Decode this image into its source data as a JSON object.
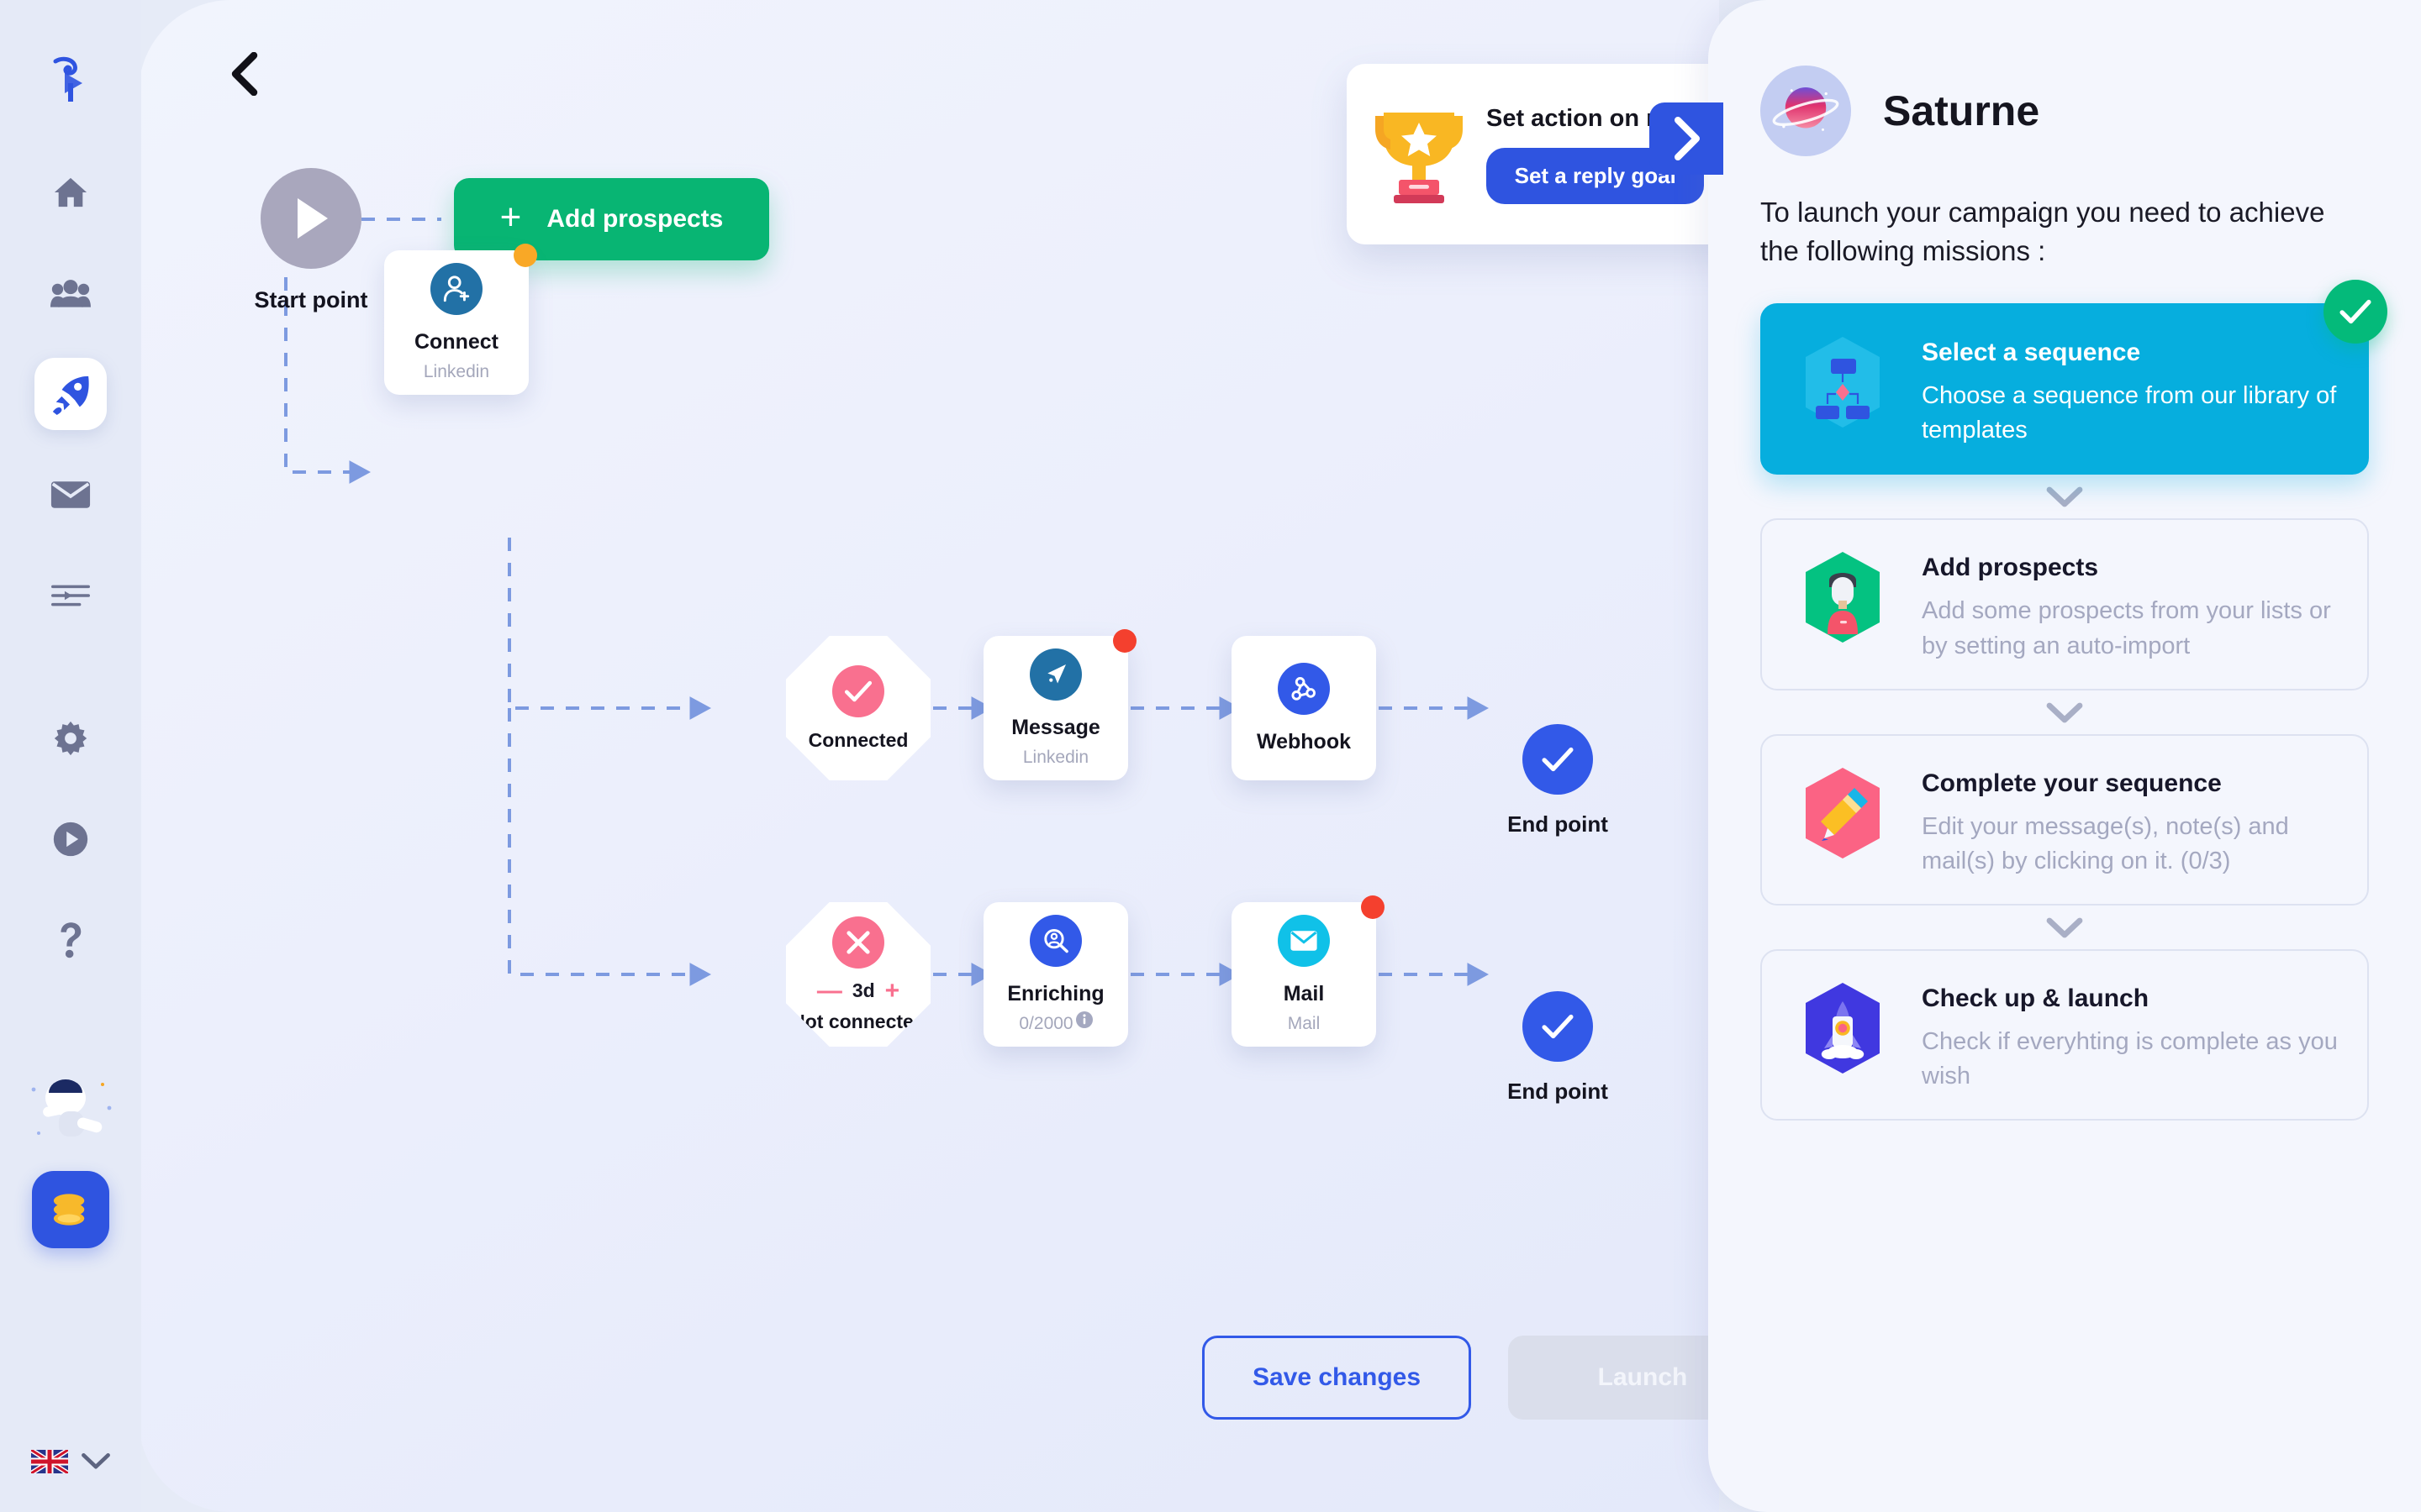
{
  "sidebar": {
    "logo_icon": "waalaxy-bird-logo",
    "items": [
      {
        "name": "home",
        "icon": "home-icon",
        "active": false
      },
      {
        "name": "prospects",
        "icon": "people-icon",
        "active": false
      },
      {
        "name": "campaigns",
        "icon": "rocket-icon",
        "active": true
      },
      {
        "name": "inbox",
        "icon": "mail-icon",
        "active": false
      },
      {
        "name": "queue",
        "icon": "list-icon",
        "active": false
      },
      {
        "name": "settings",
        "icon": "gear-icon",
        "active": false
      },
      {
        "name": "tutorials",
        "icon": "play-circle-icon",
        "active": false
      },
      {
        "name": "help",
        "icon": "question-mark-icon",
        "active": false
      }
    ],
    "astronaut_icon": "astronaut-illustration",
    "credits_icon": "coins-icon",
    "language_icon": "uk-flag-icon",
    "language_chevron_icon": "chevron-down-icon"
  },
  "canvas": {
    "back_icon": "chevron-left-icon",
    "start": {
      "icon": "play-icon",
      "label": "Start point"
    },
    "add_prospects": {
      "plus": "+",
      "label": "Add prospects"
    },
    "nodes": [
      {
        "id": "connect",
        "icon": "user-plus-icon",
        "title": "Connect",
        "subtitle": "Linkedin",
        "badge": "orange"
      },
      {
        "id": "connected",
        "icon": "check-icon",
        "title": "Connected",
        "shape": "octagon"
      },
      {
        "id": "not-connected",
        "icon": "close-x-icon",
        "title": "Not connected",
        "shape": "octagon",
        "delay": "3d",
        "delay_minus": "—",
        "delay_plus": "+"
      },
      {
        "id": "message",
        "icon": "send-icon",
        "title": "Message",
        "subtitle": "Linkedin",
        "badge": "red"
      },
      {
        "id": "webhook",
        "icon": "webhook-icon",
        "title": "Webhook",
        "subtitle": ""
      },
      {
        "id": "enriching",
        "icon": "person-search-icon",
        "title": "Enriching",
        "subtitle": "0/2000",
        "info_icon": "info-icon"
      },
      {
        "id": "mail",
        "icon": "envelope-icon",
        "title": "Mail",
        "subtitle": "Mail",
        "badge": "red"
      }
    ],
    "endpoints": [
      {
        "icon": "check-icon",
        "label": "End point"
      },
      {
        "icon": "check-icon",
        "label": "End point"
      }
    ],
    "goal_card": {
      "trophy_icon": "trophy-icon",
      "title": "Set action on reply",
      "button": "Set a reply goal"
    },
    "panel_toggle_icon": "chevron-right-icon",
    "footer": {
      "save": "Save changes",
      "launch": "Launch"
    }
  },
  "panel": {
    "avatar_icon": "saturn-planet-icon",
    "title": "Saturne",
    "intro": "To launch your campaign you need to achieve the following missions :",
    "chevron_icon": "chevron-down-icon",
    "check_icon": "check-icon",
    "missions": [
      {
        "icon": "sequence-flow-hex-icon",
        "name": "Select a sequence",
        "desc": "Choose a sequence from our library of templates",
        "done": true
      },
      {
        "icon": "person-hex-icon",
        "name": "Add prospects",
        "desc": "Add some prospects from your lists or by setting an auto-import",
        "done": false
      },
      {
        "icon": "pencil-hex-icon",
        "name": "Complete your sequence",
        "desc": "Edit your message(s), note(s) and mail(s) by clicking on it. (0/3)",
        "done": false
      },
      {
        "icon": "rocket-hex-icon",
        "name": "Check up & launch",
        "desc": "Check if everyhting is complete as you wish",
        "done": false
      }
    ]
  },
  "colors": {
    "accent_blue": "#2f54e0",
    "green": "#08b573",
    "cyan": "#06aede",
    "pink": "#f9708f",
    "orange_badge": "#f9a826",
    "red_badge": "#f4402e",
    "linkedin_blue": "#2271a6"
  }
}
